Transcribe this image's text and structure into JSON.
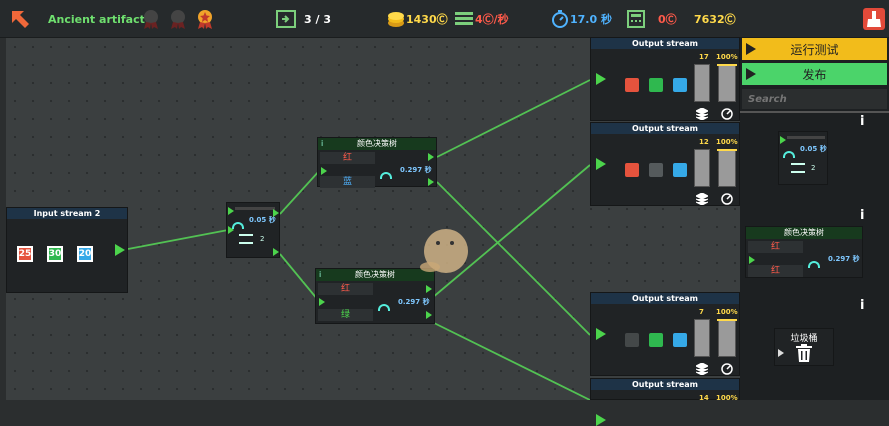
{
  "topbar": {
    "title": "Ancient artifact",
    "level": "3 / 3",
    "coins": "1430Ⓒ",
    "rate": "4Ⓒ/秒",
    "speed": "17.0 秒",
    "cost": "0Ⓒ",
    "total": "7632Ⓒ"
  },
  "input_node": {
    "title": "Input stream 2",
    "items": [
      "25",
      "30",
      "20"
    ],
    "colors": [
      "#e5533d",
      "#2fb84f",
      "#35a9e8"
    ]
  },
  "speed_node": {
    "speed": "0.05 秒",
    "count": "2"
  },
  "decision_nodes": [
    {
      "title": "颜色决策树",
      "info": "i",
      "row1": "红",
      "row2": "蓝",
      "speed": "0.297 秒"
    },
    {
      "title": "颜色决策树",
      "info": "i",
      "row1": "红",
      "row2": "绿",
      "speed": "0.297 秒"
    }
  ],
  "outputs": [
    {
      "title": "Output stream",
      "count": "17",
      "pct": "100%",
      "fill": 1.0,
      "squares": [
        "#e5533d",
        "#2fb84f",
        "#35a9e8"
      ]
    },
    {
      "title": "Output stream",
      "count": "12",
      "pct": "100%",
      "fill": 1.0,
      "squares": [
        "#e5533d",
        "#555a5c",
        "#35a9e8"
      ]
    },
    {
      "title": "Output stream",
      "count": "7",
      "pct": "100%",
      "fill": 1.0,
      "squares": [
        "#444849",
        "#2fb84f",
        "#35a9e8"
      ]
    },
    {
      "title": "Output stream",
      "count": "14",
      "pct": "100%",
      "fill": 1.0,
      "squares": []
    }
  ],
  "panel": {
    "run_test": "运行测试",
    "publish": "发布",
    "search_placeholder": "Search",
    "info": "i",
    "speed_item": {
      "speed": "0.05 秒",
      "count": "2"
    },
    "decision_item": {
      "title": "颜色决策树",
      "row1": "红",
      "row2": "红",
      "speed": "0.297 秒"
    },
    "trash_label": "垃圾桶"
  },
  "colors": {
    "accent_green": "#4cd44c",
    "run_yellow": "#f2bc1b",
    "publish_green": "#4bd46a",
    "gold": "#ffd94a"
  }
}
